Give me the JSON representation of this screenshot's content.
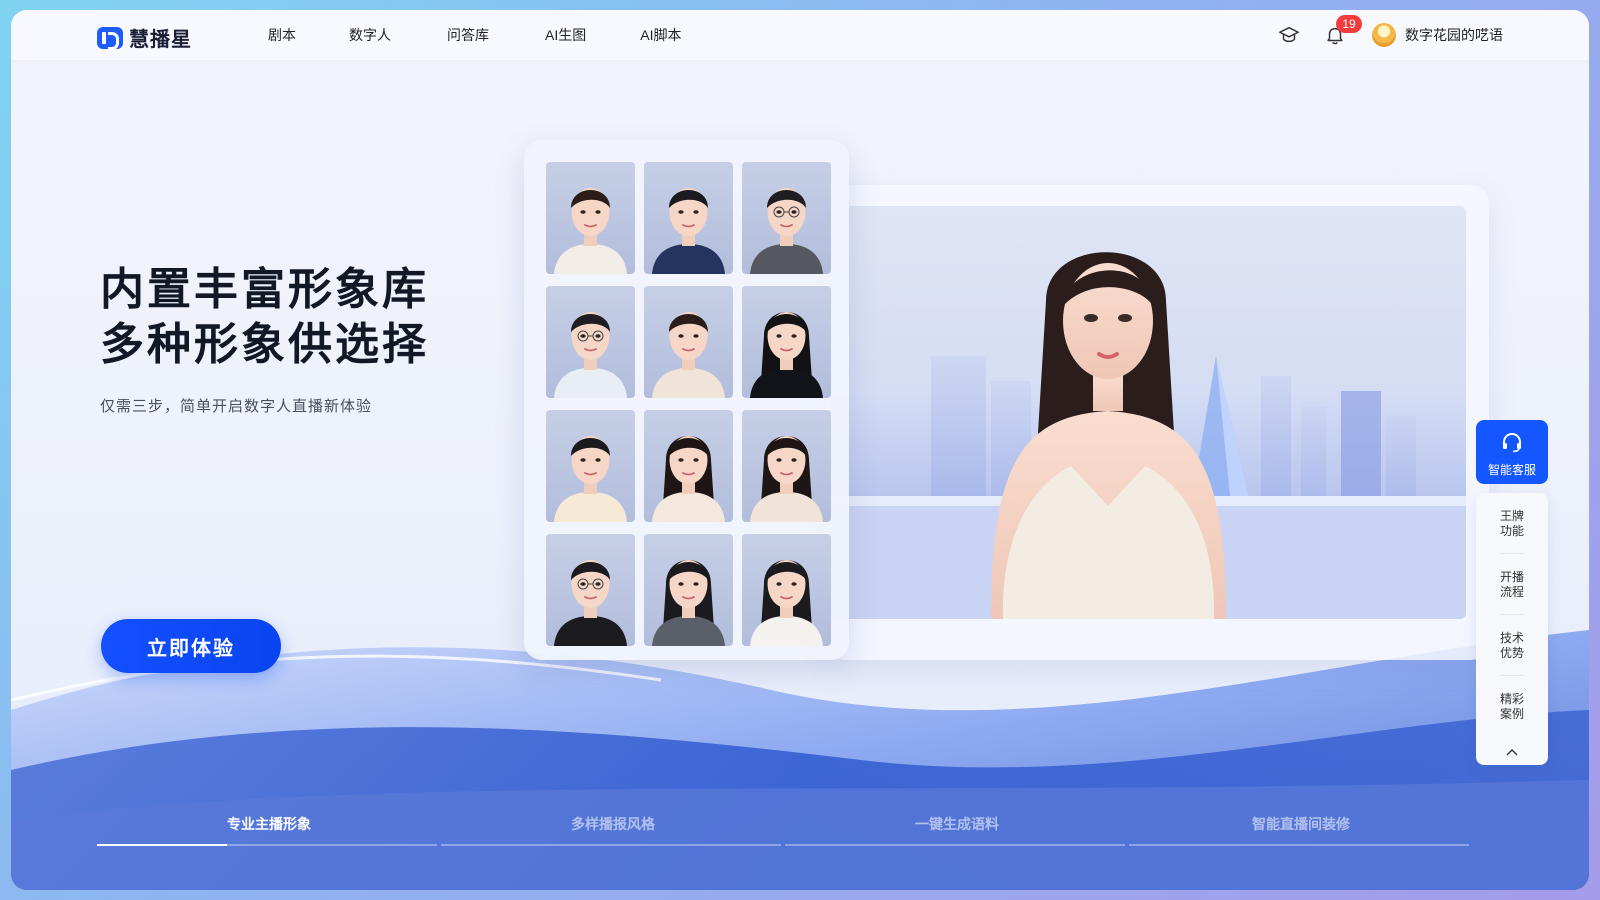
{
  "app": {
    "name": "慧播星"
  },
  "nav": {
    "items": [
      {
        "label": "剧本"
      },
      {
        "label": "数字人"
      },
      {
        "label": "问答库"
      },
      {
        "label": "AI生图"
      },
      {
        "label": "AI脚本"
      }
    ],
    "notification_count": "19",
    "username": "数字花园的呓语"
  },
  "hero": {
    "title_line1": "内置丰富形象库",
    "title_line2": "多种形象供选择",
    "subtitle": "仅需三步，简单开启数字人直播新体验",
    "cta_label": "立即体验"
  },
  "tabs": [
    {
      "label": "专业主播形象",
      "active": true
    },
    {
      "label": "多样播报风格",
      "active": false
    },
    {
      "label": "一键生成语料",
      "active": false
    },
    {
      "label": "智能直播间装修",
      "active": false
    }
  ],
  "side": {
    "service_label": "智能客服",
    "items": [
      {
        "line1": "王牌",
        "line2": "功能"
      },
      {
        "line1": "开播",
        "line2": "流程"
      },
      {
        "line1": "技术",
        "line2": "优势"
      },
      {
        "line1": "精彩",
        "line2": "案例"
      }
    ]
  },
  "colors": {
    "brand": "#1e5cff",
    "badge": "#f23c3c",
    "cta": "#1450ff"
  }
}
